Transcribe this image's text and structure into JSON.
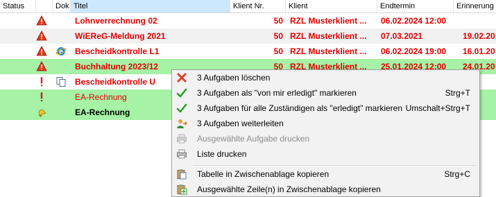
{
  "header": {
    "status": "Status",
    "dok": "Dok",
    "titel": "Titel",
    "klient_nr": "Klient Nr.",
    "klient": "Klient",
    "endtermin": "Endtermin",
    "erinnerung": "Erinnerung"
  },
  "rows": [
    {
      "titel": "Lohnverrechnung 02",
      "klient_nr": "50",
      "klient": "RZL Musterklient ...",
      "endtermin": "06.02.2024 12:00",
      "erinnerung": "",
      "status_icon": "warning-icon",
      "dok_icon": ""
    },
    {
      "titel": "WiEReG-Meldung 2021",
      "klient_nr": "50",
      "klient": "RZL Musterklient ...",
      "endtermin": "07.03.2021",
      "erinnerung": "19.02.20",
      "status_icon": "warning-icon",
      "dok_icon": ""
    },
    {
      "titel": "Bescheidkontrolle L1",
      "klient_nr": "50",
      "klient": "RZL Musterklient ...",
      "endtermin": "06.02.2024 19:00",
      "erinnerung": "16.01.20",
      "status_icon": "warning-icon",
      "dok_icon": "browser-icon"
    },
    {
      "titel": "Buchhaltung 2023/12",
      "klient_nr": "50",
      "klient": "RZL Musterklient ...",
      "endtermin": "25.01.2024 12:00",
      "erinnerung": "24.01.20",
      "status_icon": "warning-icon",
      "dok_icon": ""
    },
    {
      "titel": "Bescheidkontrolle U",
      "klient_nr": "",
      "klient": "",
      "endtermin": "",
      "erinnerung": "",
      "status_icon": "exclamation-icon",
      "dok_icon": "copy-document-icon"
    },
    {
      "titel": "EA-Rechnung",
      "klient_nr": "",
      "klient": "",
      "endtermin": "",
      "erinnerung": "",
      "status_icon": "exclamation-icon",
      "dok_icon": ""
    },
    {
      "titel": "EA-Rechnung",
      "klient_nr": "",
      "klient": "",
      "endtermin": "",
      "erinnerung": "",
      "status_icon": "bell-icon",
      "dok_icon": ""
    }
  ],
  "context_menu": {
    "items": [
      {
        "label": "3 Aufgaben löschen",
        "shortcut": "",
        "icon": "delete-x-icon",
        "disabled": false
      },
      {
        "label": "3 Aufgaben als \"von mir erledigt\" markieren",
        "shortcut": "Strg+T",
        "icon": "checkmark-icon",
        "disabled": false
      },
      {
        "label": "3 Aufgaben für alle Zuständigen als \"erledigt\" markieren",
        "shortcut": "Umschalt+Strg+T",
        "icon": "checkmark-icon",
        "disabled": false
      },
      {
        "label": "3 Aufgaben weiterleiten",
        "shortcut": "",
        "icon": "forward-user-icon",
        "disabled": false
      },
      {
        "label": "Ausgewählte Aufgabe drucken",
        "shortcut": "",
        "icon": "printer-icon",
        "disabled": true
      },
      {
        "label": "Liste drucken",
        "shortcut": "",
        "icon": "printer-icon",
        "disabled": false
      },
      {
        "label": "Tabelle in Zwischenablage kopieren",
        "shortcut": "Strg+C",
        "icon": "clipboard-icon",
        "disabled": false
      },
      {
        "label": "Ausgewählte Zeile(n) in Zwischenablage kopieren",
        "shortcut": "",
        "icon": "clipboard-add-icon",
        "disabled": false
      }
    ]
  },
  "colors": {
    "selected_row": "#a6f2a6",
    "overdue_text": "#e00000",
    "sorted_header": "#cce8ff"
  }
}
